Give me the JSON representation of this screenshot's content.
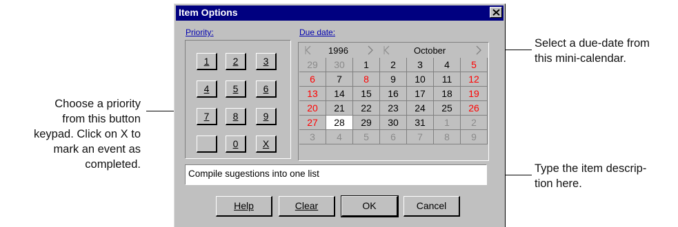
{
  "dialog": {
    "title": "Item Options",
    "close_icon": "close-x-icon"
  },
  "priority": {
    "label": "Priority:",
    "keys": [
      "1",
      "2",
      "3",
      "4",
      "5",
      "6",
      "7",
      "8",
      "9",
      "",
      "0",
      "X"
    ]
  },
  "due_date": {
    "label": "Due date:",
    "year": "1996",
    "month": "October",
    "weeks": [
      [
        {
          "d": "29",
          "t": "other"
        },
        {
          "d": "30",
          "t": "other"
        },
        {
          "d": "1",
          "t": "normal"
        },
        {
          "d": "2",
          "t": "normal"
        },
        {
          "d": "3",
          "t": "normal"
        },
        {
          "d": "4",
          "t": "normal"
        },
        {
          "d": "5",
          "t": "weekend"
        }
      ],
      [
        {
          "d": "6",
          "t": "weekend"
        },
        {
          "d": "7",
          "t": "normal"
        },
        {
          "d": "8",
          "t": "weekend"
        },
        {
          "d": "9",
          "t": "normal"
        },
        {
          "d": "10",
          "t": "normal"
        },
        {
          "d": "11",
          "t": "normal"
        },
        {
          "d": "12",
          "t": "weekend"
        }
      ],
      [
        {
          "d": "13",
          "t": "weekend"
        },
        {
          "d": "14",
          "t": "normal"
        },
        {
          "d": "15",
          "t": "normal"
        },
        {
          "d": "16",
          "t": "normal"
        },
        {
          "d": "17",
          "t": "normal"
        },
        {
          "d": "18",
          "t": "normal"
        },
        {
          "d": "19",
          "t": "weekend"
        }
      ],
      [
        {
          "d": "20",
          "t": "weekend"
        },
        {
          "d": "21",
          "t": "normal"
        },
        {
          "d": "22",
          "t": "normal"
        },
        {
          "d": "23",
          "t": "normal"
        },
        {
          "d": "24",
          "t": "normal"
        },
        {
          "d": "25",
          "t": "normal"
        },
        {
          "d": "26",
          "t": "weekend"
        }
      ],
      [
        {
          "d": "27",
          "t": "weekend"
        },
        {
          "d": "28",
          "t": "today"
        },
        {
          "d": "29",
          "t": "normal"
        },
        {
          "d": "30",
          "t": "normal"
        },
        {
          "d": "31",
          "t": "normal"
        },
        {
          "d": "1",
          "t": "other"
        },
        {
          "d": "2",
          "t": "other"
        }
      ],
      [
        {
          "d": "3",
          "t": "other"
        },
        {
          "d": "4",
          "t": "other"
        },
        {
          "d": "5",
          "t": "other"
        },
        {
          "d": "6",
          "t": "other"
        },
        {
          "d": "7",
          "t": "other"
        },
        {
          "d": "8",
          "t": "other"
        },
        {
          "d": "9",
          "t": "other"
        }
      ]
    ]
  },
  "description": {
    "value": "Compile sugestions into one list"
  },
  "buttons": {
    "help": "Help",
    "clear": "Clear",
    "ok": "OK",
    "cancel": "Cancel"
  },
  "callouts": {
    "priority": [
      "Choose a priority",
      "from this button",
      "keypad. Click on X to",
      "mark an event as",
      "completed."
    ],
    "calendar": [
      "Select a due-date from",
      "this mini-calendar."
    ],
    "description": [
      "Type the item descrip-",
      "tion here."
    ]
  },
  "colors": {
    "titlebar": "#000080",
    "dialog_face": "#c0c0c0",
    "weekend_day": "#ff0000",
    "other_month_day": "#8a8a8a",
    "group_label": "#0000b0"
  }
}
